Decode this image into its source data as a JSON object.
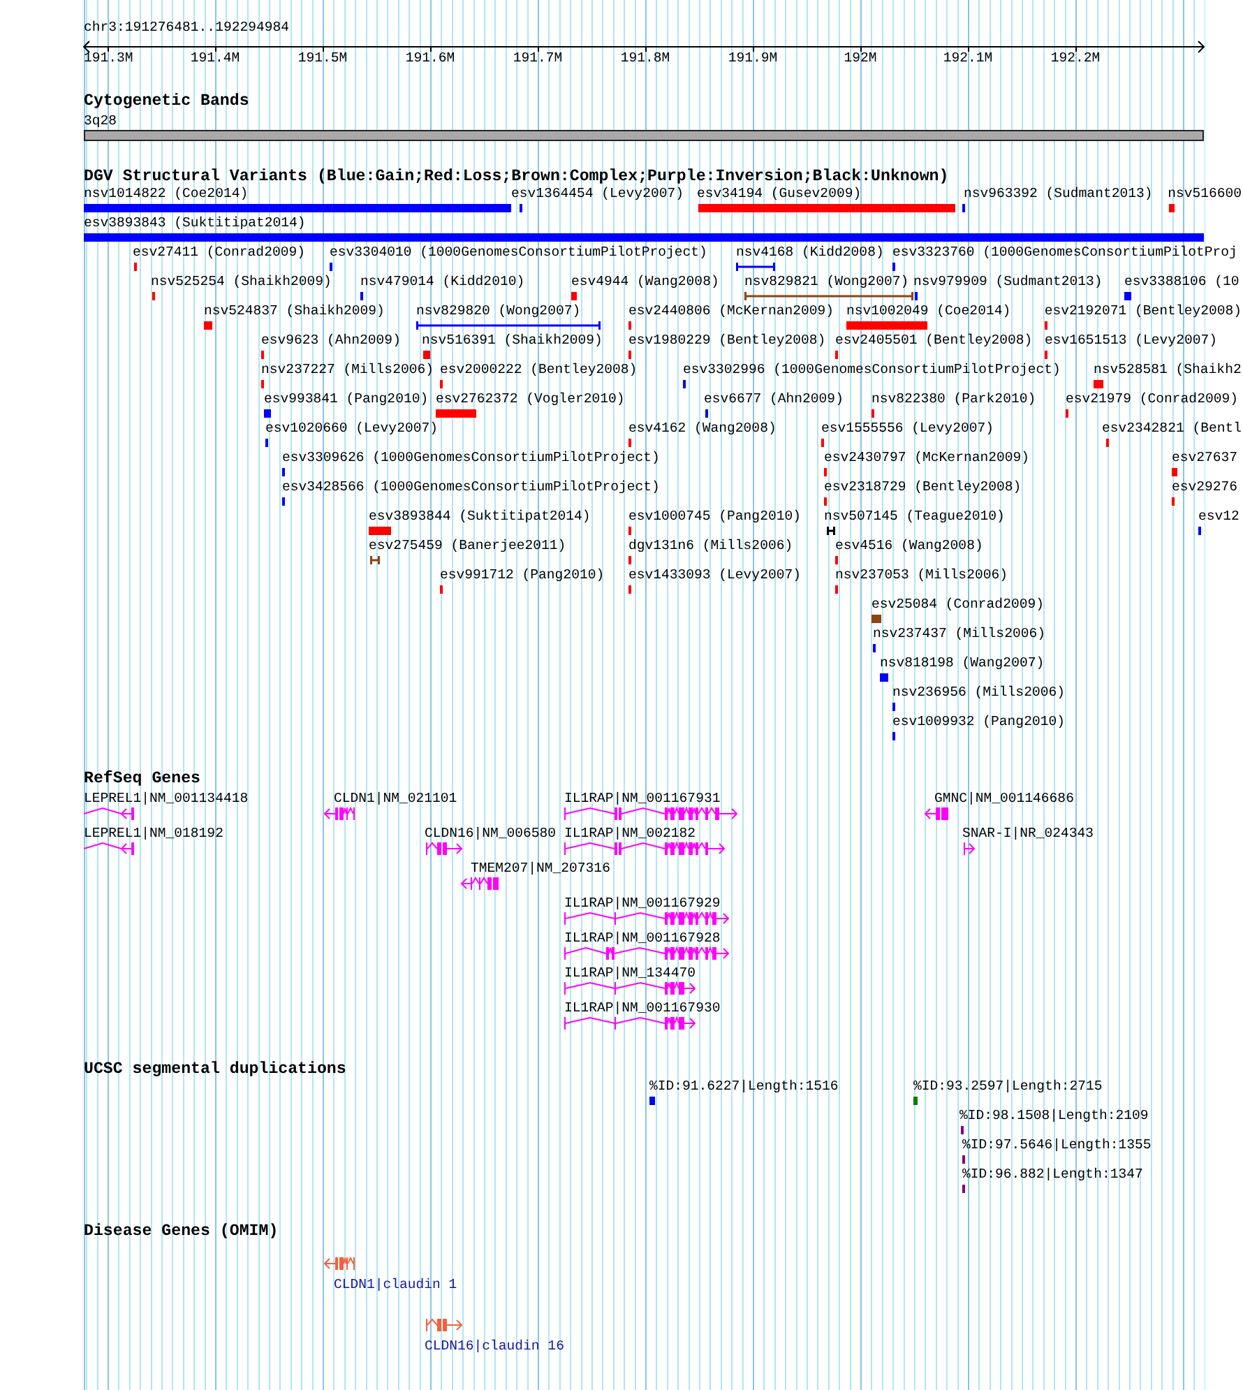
{
  "ruler": {
    "region": "chr3:191276481..192294984",
    "ticks": [
      "191.3M",
      "191.4M",
      "191.5M",
      "191.6M",
      "191.7M",
      "191.8M",
      "191.9M",
      "192M",
      "192.1M",
      "192.2M"
    ]
  },
  "tracks": [
    {
      "kind": "cytoband",
      "title": "Cytogenetic Bands",
      "bands": [
        {
          "label": "3q28"
        }
      ]
    },
    {
      "kind": "variants",
      "title": "DGV Structural Variants (Blue:Gain;Red:Loss;Brown:Complex;Purple:Inversion;Black:Unknown)",
      "features": [
        {
          "label": "nsv1014822 (Coe2014)",
          "kind": "box",
          "color": "#0000ff"
        },
        {
          "label": "esv1364454 (Levy2007)",
          "kind": "box",
          "color": "#0000ff"
        },
        {
          "label": "esv34194 (Gusev2009)",
          "kind": "box",
          "color": "#ff0000"
        },
        {
          "label": "nsv963392 (Sudmant2013)",
          "kind": "box",
          "color": "#0000ff"
        },
        {
          "label": "nsv516600",
          "kind": "box",
          "color": "#ff0000"
        },
        {
          "label": "esv3893843 (Suktitipat2014)",
          "kind": "box",
          "color": "#0000ff"
        },
        {
          "label": "esv27411 (Conrad2009)",
          "kind": "box",
          "color": "#ff0000"
        },
        {
          "label": "esv3304010 (1000GenomesConsortiumPilotProject)",
          "kind": "box",
          "color": "#0000ff"
        },
        {
          "label": "nsv4168 (Kidd2008)",
          "kind": "span",
          "color": "#0000ff"
        },
        {
          "label": "esv3323760 (1000GenomesConsortiumPilotProj",
          "kind": "box",
          "color": "#0000ff"
        },
        {
          "label": "nsv525254 (Shaikh2009)",
          "kind": "box",
          "color": "#ff0000"
        },
        {
          "label": "nsv479014 (Kidd2010)",
          "kind": "box",
          "color": "#0000ff"
        },
        {
          "label": "esv4944 (Wang2008)",
          "kind": "box",
          "color": "#ff0000"
        },
        {
          "label": "nsv829821 (Wong2007)",
          "kind": "span",
          "color": "#8b4513"
        },
        {
          "label": "nsv979909 (Sudmant2013)",
          "kind": "box",
          "color": "#0000ff"
        },
        {
          "label": "esv3388106 (10",
          "kind": "box",
          "color": "#0000ff"
        },
        {
          "label": "nsv524837 (Shaikh2009)",
          "kind": "box",
          "color": "#ff0000"
        },
        {
          "label": "nsv829820 (Wong2007)",
          "kind": "span",
          "color": "#0000ff"
        },
        {
          "label": "esv2440806 (McKernan2009)",
          "kind": "box",
          "color": "#ff0000"
        },
        {
          "label": "nsv1002049 (Coe2014)",
          "kind": "box",
          "color": "#ff0000"
        },
        {
          "label": "esv2192071 (Bentley2008)",
          "kind": "box",
          "color": "#ff0000"
        },
        {
          "label": "esv9623 (Ahn2009)",
          "kind": "box",
          "color": "#ff0000"
        },
        {
          "label": "nsv516391 (Shaikh2009)",
          "kind": "box",
          "color": "#ff0000"
        },
        {
          "label": "esv1980229 (Bentley2008)",
          "kind": "box",
          "color": "#ff0000"
        },
        {
          "label": "esv2405501 (Bentley2008)",
          "kind": "box",
          "color": "#ff0000"
        },
        {
          "label": "esv1651513 (Levy2007)",
          "kind": "box",
          "color": "#ff0000"
        },
        {
          "label": "nsv237227 (Mills2006)",
          "kind": "box",
          "color": "#ff0000"
        },
        {
          "label": "esv2000222 (Bentley2008)",
          "kind": "box",
          "color": "#ff0000"
        },
        {
          "label": "esv3302996 (1000GenomesConsortiumPilotProject)",
          "kind": "box",
          "color": "#0000ff"
        },
        {
          "label": "nsv528581 (Shaikh2",
          "kind": "box",
          "color": "#ff0000"
        },
        {
          "label": "esv993841 (Pang2010)",
          "kind": "box",
          "color": "#0000ff"
        },
        {
          "label": "esv2762372 (Vogler2010)",
          "kind": "box",
          "color": "#ff0000"
        },
        {
          "label": "esv6677 (Ahn2009)",
          "kind": "box",
          "color": "#0000ff"
        },
        {
          "label": "nsv822380 (Park2010)",
          "kind": "box",
          "color": "#ff0000"
        },
        {
          "label": "esv21979 (Conrad2009)",
          "kind": "box",
          "color": "#ff0000"
        },
        {
          "label": "esv1020660 (Levy2007)",
          "kind": "box",
          "color": "#0000ff"
        },
        {
          "label": "esv4162 (Wang2008)",
          "kind": "box",
          "color": "#ff0000"
        },
        {
          "label": "esv1555556 (Levy2007)",
          "kind": "box",
          "color": "#ff0000"
        },
        {
          "label": "esv2342821 (Bentl",
          "kind": "box",
          "color": "#ff0000"
        },
        {
          "label": "esv3309626 (1000GenomesConsortiumPilotProject)",
          "kind": "box",
          "color": "#0000ff"
        },
        {
          "label": "esv2430797 (McKernan2009)",
          "kind": "box",
          "color": "#ff0000"
        },
        {
          "label": "esv27637",
          "kind": "box",
          "color": "#ff0000"
        },
        {
          "label": "esv3428566 (1000GenomesConsortiumPilotProject)",
          "kind": "box",
          "color": "#0000ff"
        },
        {
          "label": "esv2318729 (Bentley2008)",
          "kind": "box",
          "color": "#ff0000"
        },
        {
          "label": "esv29276",
          "kind": "box",
          "color": "#ff0000"
        },
        {
          "label": "esv3893844 (Suktitipat2014)",
          "kind": "box",
          "color": "#ff0000"
        },
        {
          "label": "esv1000745 (Pang2010)",
          "kind": "box",
          "color": "#ff0000"
        },
        {
          "label": "nsv507145 (Teague2010)",
          "kind": "span",
          "color": "#000000"
        },
        {
          "label": "esv12",
          "kind": "box",
          "color": "#0000ff"
        },
        {
          "label": "esv275459 (Banerjee2011)",
          "kind": "span",
          "color": "#8b4513"
        },
        {
          "label": "dgv131n6 (Mills2006)",
          "kind": "box",
          "color": "#ff0000"
        },
        {
          "label": "esv4516 (Wang2008)",
          "kind": "box",
          "color": "#ff0000"
        },
        {
          "label": "esv991712 (Pang2010)",
          "kind": "box",
          "color": "#ff0000"
        },
        {
          "label": "esv1433093 (Levy2007)",
          "kind": "box",
          "color": "#ff0000"
        },
        {
          "label": "nsv237053 (Mills2006)",
          "kind": "box",
          "color": "#ff0000"
        },
        {
          "label": "esv25084 (Conrad2009)",
          "kind": "box",
          "color": "#8b4513"
        },
        {
          "label": "nsv237437 (Mills2006)",
          "kind": "box",
          "color": "#0000ff"
        },
        {
          "label": "nsv818198 (Wang2007)",
          "kind": "box",
          "color": "#0000ff"
        },
        {
          "label": "nsv236956 (Mills2006)",
          "kind": "box",
          "color": "#0000ff"
        },
        {
          "label": "esv1009932 (Pang2010)",
          "kind": "box",
          "color": "#0000ff"
        }
      ]
    },
    {
      "kind": "genes",
      "title": "RefSeq Genes",
      "features": [
        {
          "label": "LEPREL1|NM_001134418",
          "kind": "reverse"
        },
        {
          "label": "CLDN1|NM_021101",
          "kind": "reverse"
        },
        {
          "label": "IL1RAP|NM_001167931",
          "kind": "forward"
        },
        {
          "label": "GMNC|NM_001146686",
          "kind": "reverse"
        },
        {
          "label": "LEPREL1|NM_018192",
          "kind": "reverse"
        },
        {
          "label": "CLDN16|NM_006580",
          "kind": "forward"
        },
        {
          "label": "IL1RAP|NM_002182",
          "kind": "forward"
        },
        {
          "label": "SNAR-I|NR_024343",
          "kind": "forward"
        },
        {
          "label": "TMEM207|NM_207316",
          "kind": "reverse"
        },
        {
          "label": "IL1RAP|NM_001167929",
          "kind": "forward"
        },
        {
          "label": "IL1RAP|NM_001167928",
          "kind": "forward"
        },
        {
          "label": "IL1RAP|NM_134470",
          "kind": "forward"
        },
        {
          "label": "IL1RAP|NM_001167930",
          "kind": "forward"
        }
      ]
    },
    {
      "kind": "duplications",
      "title": "UCSC segmental duplications",
      "features": [
        {
          "label": "%ID:91.6227|Length:1516",
          "color": "#0000ff"
        },
        {
          "label": "%ID:93.2597|Length:2715",
          "color": "#008000"
        },
        {
          "label": "%ID:98.1508|Length:2109",
          "color": "#800080"
        },
        {
          "label": "%ID:97.5646|Length:1355",
          "color": "#800080"
        },
        {
          "label": "%ID:96.882|Length:1347",
          "color": "#800080"
        }
      ]
    },
    {
      "kind": "disease-genes",
      "title": "Disease Genes (OMIM)",
      "features": [
        {
          "label": "CLDN1|claudin 1",
          "kind": "reverse"
        },
        {
          "label": "CLDN16|claudin 16",
          "kind": "forward"
        }
      ]
    }
  ]
}
